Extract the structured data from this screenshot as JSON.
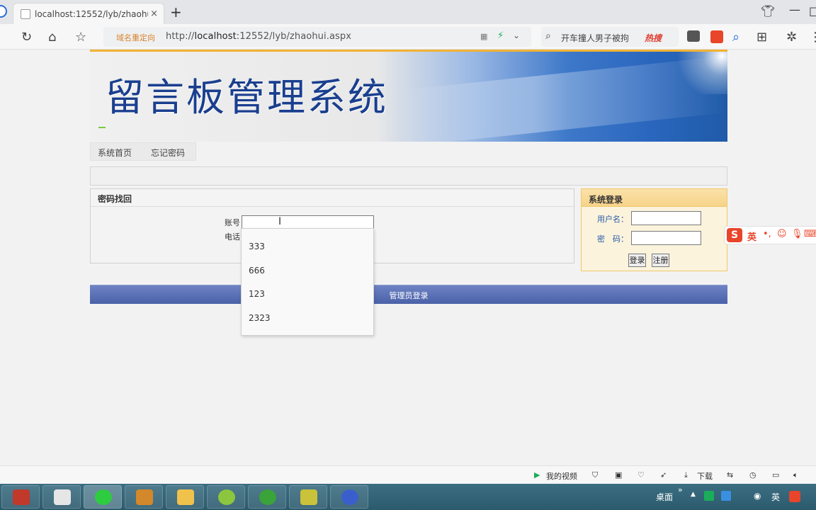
{
  "browser": {
    "tab_title": "localhost:12552/lyb/zhaohui.a",
    "tab_close": "×",
    "new_tab": "+",
    "redirect_label": "域名重定向",
    "url_prefix": "http://",
    "url_host": "localhost",
    "url_rest": ":12552/lyb/zhaohui.aspx",
    "search_text": "开车撞人男子被拘",
    "hot_label": "热搜"
  },
  "header": {
    "site_title": "留言板管理系统"
  },
  "menu": {
    "items": [
      {
        "label": "系统首页"
      },
      {
        "label": "忘记密码"
      }
    ]
  },
  "recover_panel": {
    "title": "密码找回",
    "account_label": "账号",
    "phone_label": "电话",
    "account_value": ""
  },
  "autocomplete": {
    "options": [
      "333",
      "666",
      "123",
      "2323"
    ]
  },
  "login_panel": {
    "title": "系统登录",
    "username_label": "用户名：",
    "password_label": "密　码：",
    "login_button": "登录",
    "register_button": "注册"
  },
  "admin_bar": {
    "label": "管理员登录"
  },
  "ime": {
    "label": "英"
  },
  "statusbar": {
    "video_label": "我的视频",
    "download_label": "下载"
  },
  "taskbar": {
    "desktop_label": "桌面",
    "lang_label": "英"
  },
  "colors": {
    "accent_title": "#1a3f8f",
    "admin_bar": "#5b70b6",
    "login_panel_bg": "#fbf3dc"
  }
}
